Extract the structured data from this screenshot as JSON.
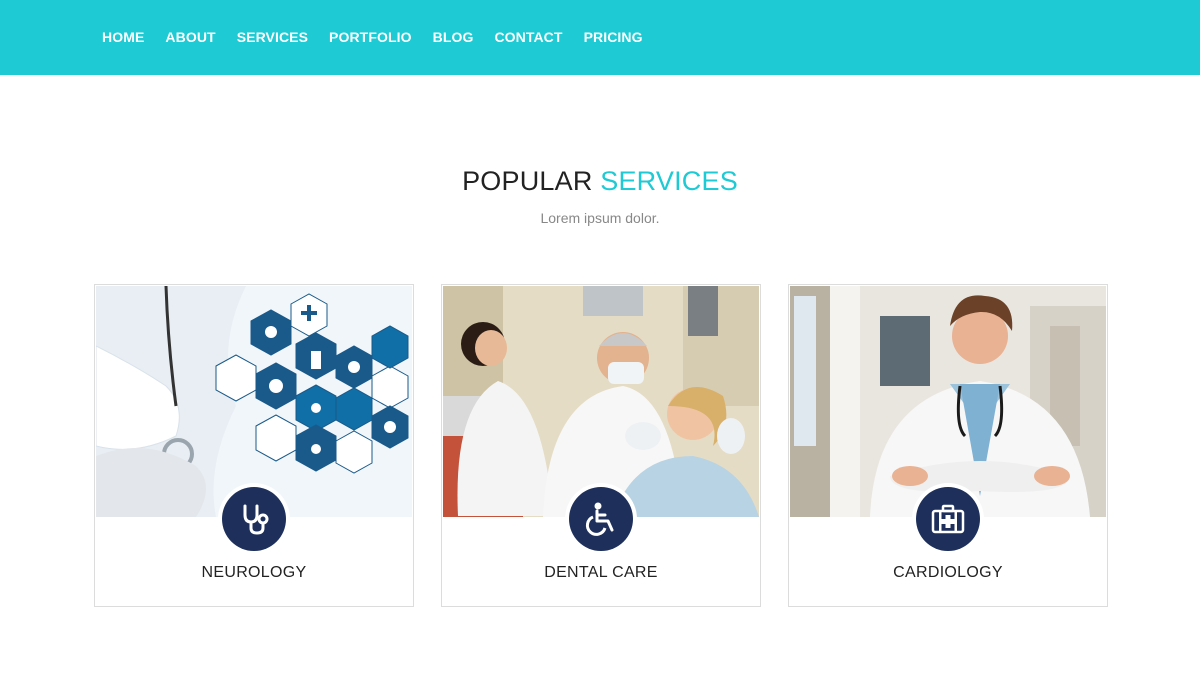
{
  "nav": {
    "items": [
      {
        "label": "HOME"
      },
      {
        "label": "ABOUT"
      },
      {
        "label": "SERVICES"
      },
      {
        "label": "PORTFOLIO"
      },
      {
        "label": "BLOG"
      },
      {
        "label": "CONTACT"
      },
      {
        "label": "PRICING"
      }
    ]
  },
  "section": {
    "title_main": "POPULAR",
    "title_accent": "SERVICES",
    "subtitle": "Lorem ipsum dolor."
  },
  "cards": [
    {
      "title": "NEUROLOGY",
      "icon": "stethoscope-icon"
    },
    {
      "title": "DENTAL CARE",
      "icon": "wheelchair-icon"
    },
    {
      "title": "CARDIOLOGY",
      "icon": "medical-kit-icon"
    }
  ],
  "colors": {
    "accent": "#1ecad3",
    "icon_circle": "#1d2f5a",
    "text": "#222222",
    "subtitle": "#888888"
  }
}
